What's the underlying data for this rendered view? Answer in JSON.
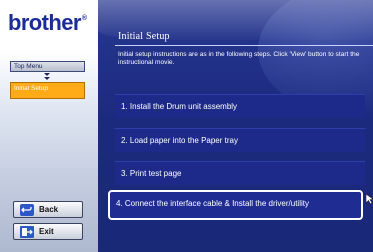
{
  "sidebar": {
    "logo_text": "brother",
    "logo_mark": "®",
    "nav_top_label": "Top Menu",
    "nav_current_label": "Initial Setup",
    "back_label": "Back",
    "exit_label": "Exit"
  },
  "main": {
    "title": "Initial Setup",
    "intro": "Initial setup instructions are as in the following steps. Click 'View' button to start the instructional movie.",
    "steps": [
      {
        "label": "1. Install the Drum unit assembly"
      },
      {
        "label": "2. Load paper into the Paper tray"
      },
      {
        "label": "3. Print test page"
      },
      {
        "label": "4. Connect the interface cable & Install the driver/utility"
      }
    ]
  },
  "colors": {
    "brand": "#1a2b9a",
    "panel": "#1c2a7e",
    "highlight": "#ffaa17"
  },
  "icons": {
    "nav_arrow": "chevron-down-double-icon",
    "back": "back-arrow-icon",
    "exit": "exit-icon",
    "pointer": "pointer-arrow-icon"
  }
}
